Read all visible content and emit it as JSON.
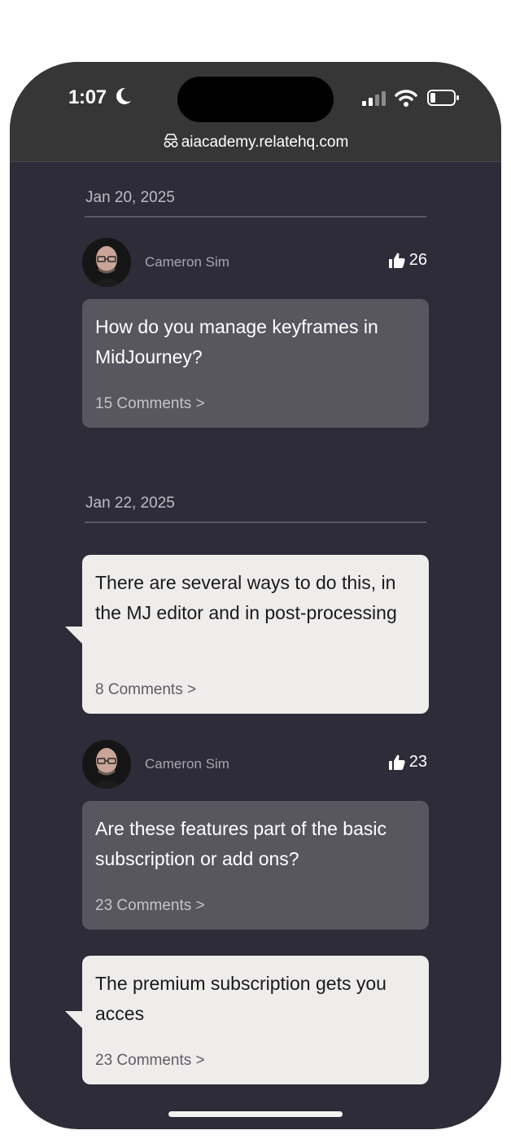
{
  "status_bar": {
    "time": "1:07",
    "url": "aiacademy.relatehq.com"
  },
  "feed": [
    {
      "date": "Jan 20, 2025"
    },
    {
      "author": "Cameron Sim",
      "likes": "26",
      "question": "How do you manage keyframes in MidJourney?",
      "comments": "15 Comments >"
    },
    {
      "date": "Jan 22, 2025"
    },
    {
      "reply": "There are several ways to do this, in the MJ editor and in post-processing",
      "comments": "8 Comments >"
    },
    {
      "author": "Cameron Sim",
      "likes": "23",
      "question": "Are these features part of the basic subscription or add ons?",
      "comments": "23 Comments >"
    },
    {
      "reply": "The premium subscription gets you acces",
      "comments": "23 Comments >"
    }
  ],
  "colors": {
    "background": "#2e2c38",
    "question_card": "#58565f",
    "reply_card": "#efecec",
    "top_bar": "#363636"
  },
  "icons": [
    "moon-icon",
    "signal-icon",
    "wifi-icon",
    "battery-icon",
    "incognito-icon",
    "thumbs-up-icon"
  ]
}
